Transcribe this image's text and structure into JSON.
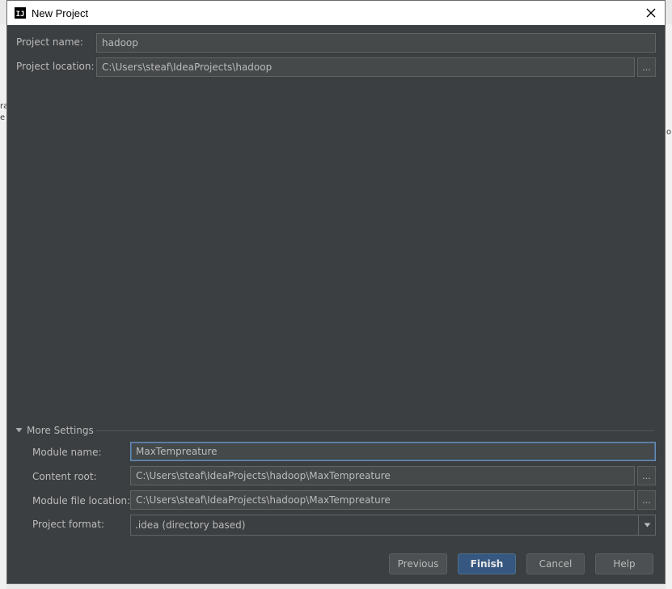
{
  "window": {
    "title": "New Project"
  },
  "project": {
    "name_label": "Project name:",
    "name_value": "hadoop",
    "location_label": "Project location:",
    "location_value": "C:\\Users\\steaf\\IdeaProjects\\hadoop",
    "browse_label": "..."
  },
  "more_settings": {
    "toggle_label": "More Settings",
    "module_name_label": "Module name:",
    "module_name_value": "MaxTempreature",
    "content_root_label": "Content root:",
    "content_root_value": "C:\\Users\\steaf\\IdeaProjects\\hadoop\\MaxTempreature",
    "module_file_label": "Module file location:",
    "module_file_value": "C:\\Users\\steaf\\IdeaProjects\\hadoop\\MaxTempreature",
    "format_label": "Project format:",
    "format_value": ".idea (directory based)"
  },
  "buttons": {
    "previous": "Previous",
    "finish": "Finish",
    "cancel": "Cancel",
    "help": "Help"
  },
  "background_fragments": {
    "left": [
      "ra",
      "e"
    ],
    "right": [
      "o"
    ]
  },
  "colors": {
    "dialog_bg": "#3c3f41",
    "field_bg": "#45494a",
    "default_button": "#365880",
    "focus_border": "#6a8db3"
  }
}
